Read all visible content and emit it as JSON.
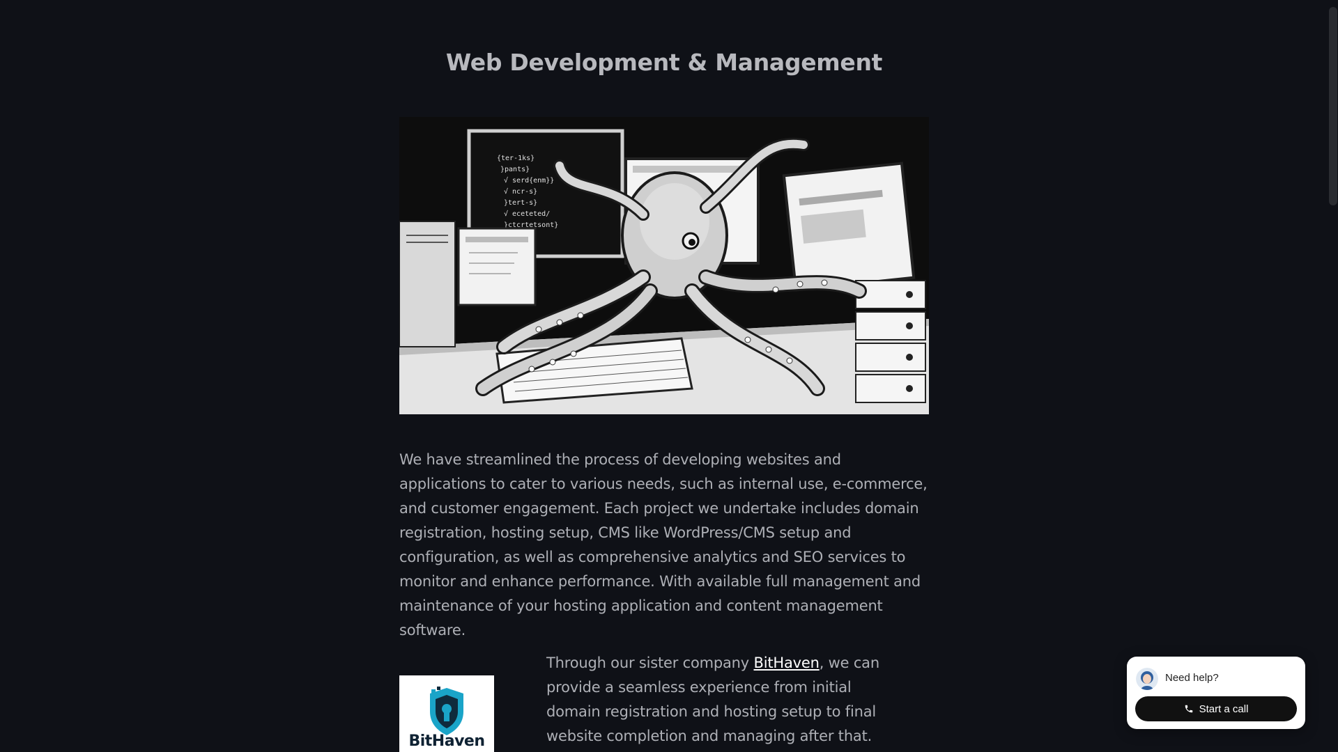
{
  "page": {
    "title": "Web Development & Management",
    "intro_paragraph": "We have streamlined the process of developing websites and applications to cater to various needs, such as internal use, e-commerce, and customer engagement. Each project we undertake includes domain registration, hosting setup, CMS like WordPress/CMS setup and configuration, as well as comprehensive analytics and SEO services to monitor and enhance performance. With available full management and maintenance of your hosting application and content management software.",
    "sister_prefix": "Through our sister company ",
    "sister_link": "BitHaven",
    "sister_suffix": ", we can provide a seamless experience from initial domain registration and hosting setup to final website completion and managing after that."
  },
  "logo": {
    "wordmark": "BitHaven",
    "icon": "shield-icon"
  },
  "help_widget": {
    "prompt": "Need help?",
    "call_label": "Start a call",
    "call_icon": "phone-icon"
  },
  "colors": {
    "background": "#0f1117",
    "title": "#b8b9be",
    "body_text": "#aeb0b6",
    "link": "#ffffff",
    "logo_teal": "#1aa4c8",
    "button": "#111111"
  }
}
